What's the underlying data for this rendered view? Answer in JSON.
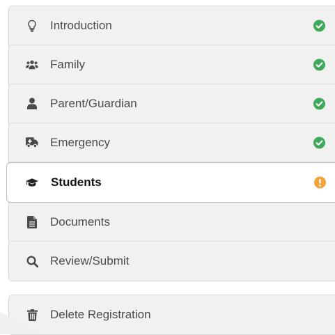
{
  "nav": {
    "items": [
      {
        "label": "Introduction",
        "icon": "lightbulb-icon",
        "status": "complete"
      },
      {
        "label": "Family",
        "icon": "users-icon",
        "status": "complete"
      },
      {
        "label": "Parent/Guardian",
        "icon": "user-icon",
        "status": "complete"
      },
      {
        "label": "Emergency",
        "icon": "ambulance-icon",
        "status": "complete"
      },
      {
        "label": "Students",
        "icon": "graduation-cap-icon",
        "status": "warning",
        "active": true
      },
      {
        "label": "Documents",
        "icon": "file-icon",
        "status": "none"
      },
      {
        "label": "Review/Submit",
        "icon": "search-icon",
        "status": "none"
      }
    ]
  },
  "delete": {
    "label": "Delete Registration",
    "icon": "trash-icon"
  },
  "colors": {
    "success": "#3eab5a",
    "warning": "#f0a43a",
    "icon": "#4a4a4a"
  }
}
